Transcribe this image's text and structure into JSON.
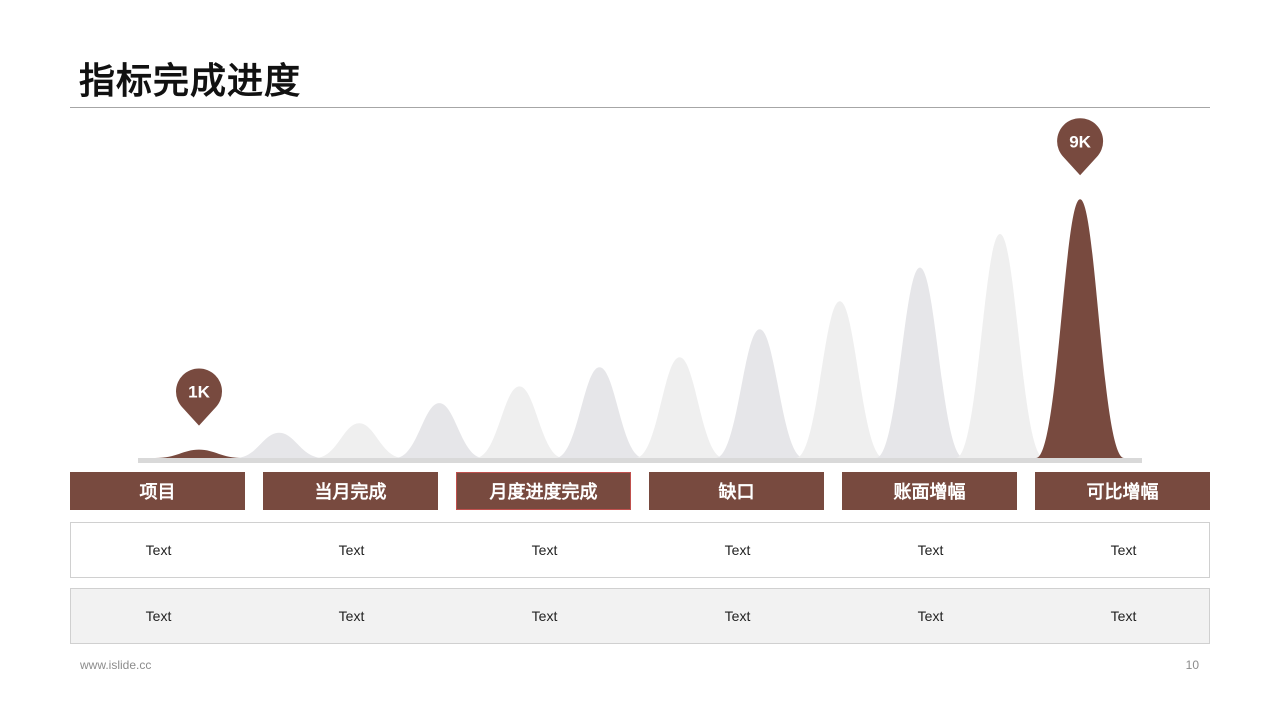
{
  "title": "指标完成进度",
  "colors": {
    "accent": "#784a3f",
    "peak_light": "#e6e6e9",
    "peak_lighter": "#efefef",
    "baseline": "#d9d9d9"
  },
  "chart_data": {
    "type": "area",
    "series": [
      {
        "values": [
          0.15,
          0.45,
          0.62,
          0.98,
          1.28,
          1.62,
          1.8,
          2.3,
          2.8,
          3.4,
          4.0,
          4.62
        ]
      }
    ],
    "highlighted_indices": [
      0,
      11
    ],
    "markers": [
      {
        "index": 0,
        "label": "1K"
      },
      {
        "index": 11,
        "label": "9K"
      }
    ]
  },
  "table": {
    "headers": [
      "项目",
      "当月完成",
      "月度进度完成",
      "缺口",
      "账面增幅",
      "可比增幅"
    ],
    "rows": [
      [
        "Text",
        "Text",
        "Text",
        "Text",
        "Text",
        "Text"
      ],
      [
        "Text",
        "Text",
        "Text",
        "Text",
        "Text",
        "Text"
      ]
    ]
  },
  "footer": {
    "url": "www.islide.cc",
    "page": "10"
  }
}
